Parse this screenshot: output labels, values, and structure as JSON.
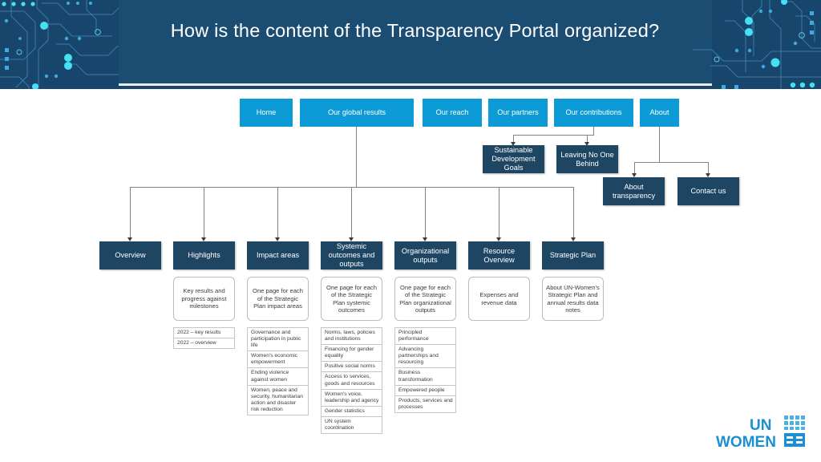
{
  "header": {
    "title": "How is the content of the Transparency Portal organized?",
    "bg_color": "#17456b",
    "panel_color": "#1b4d72",
    "accent_color": "#3fd3ef"
  },
  "colors": {
    "cyan": "#0c9bd7",
    "navy": "#1e4663",
    "connector": "#7c8489",
    "logo_blue": "#1a8fd1"
  },
  "top_nav": [
    {
      "label": "Home"
    },
    {
      "label": "Our global results"
    },
    {
      "label": "Our reach"
    },
    {
      "label": "Our partners"
    },
    {
      "label": "Our contributions"
    },
    {
      "label": "About"
    }
  ],
  "contributions_children": [
    {
      "label": "Sustainable Development Goals"
    },
    {
      "label": "Leaving No One Behind"
    }
  ],
  "about_children": [
    {
      "label": "About transparency"
    },
    {
      "label": "Contact us"
    }
  ],
  "global_results_children": [
    {
      "label": "Overview",
      "desc": "Key results and progress against milestones",
      "items": [
        "2022 – key results",
        "2022 – overview"
      ]
    },
    {
      "label": "Highlights",
      "desc": "",
      "items": []
    },
    {
      "label": "Impact areas",
      "desc": "One page for each of the Strategic Plan impact areas",
      "items": [
        "Governance and participation in public life",
        "Women's economic empowerment",
        "Ending violence against women",
        "Women, peace and security, humanitarian action and disaster risk reduction"
      ]
    },
    {
      "label": "Systemic outcomes and outputs",
      "desc": "One page for each of the Strategic Plan systemic outcomes",
      "items": [
        "Norms, laws, policies and institutions",
        "Financing for gender equality",
        "Positive social norms",
        "Access to services, goods and resources",
        "Women's voice, leadership and agency",
        "Gender statistics",
        "UN system coordination"
      ]
    },
    {
      "label": "Organizational outputs",
      "desc": "One page for each of the Strategic Plan organizational outputs",
      "items": [
        "Principled performance",
        "Advancing partnerships and resourcing",
        "Business transformation",
        "Empowered people",
        "Products, services and processes"
      ]
    },
    {
      "label": "Resource Overview",
      "desc": "Expenses and revenue data",
      "items": []
    },
    {
      "label": "Strategic Plan",
      "desc": "About UN-Women's Strategic Plan and annual results data notes",
      "items": []
    }
  ],
  "highlights_desc": "Key results and progress against milestones",
  "logo": {
    "line1": "UN",
    "line2": "WOMEN",
    "alt": "un-women-logo"
  }
}
